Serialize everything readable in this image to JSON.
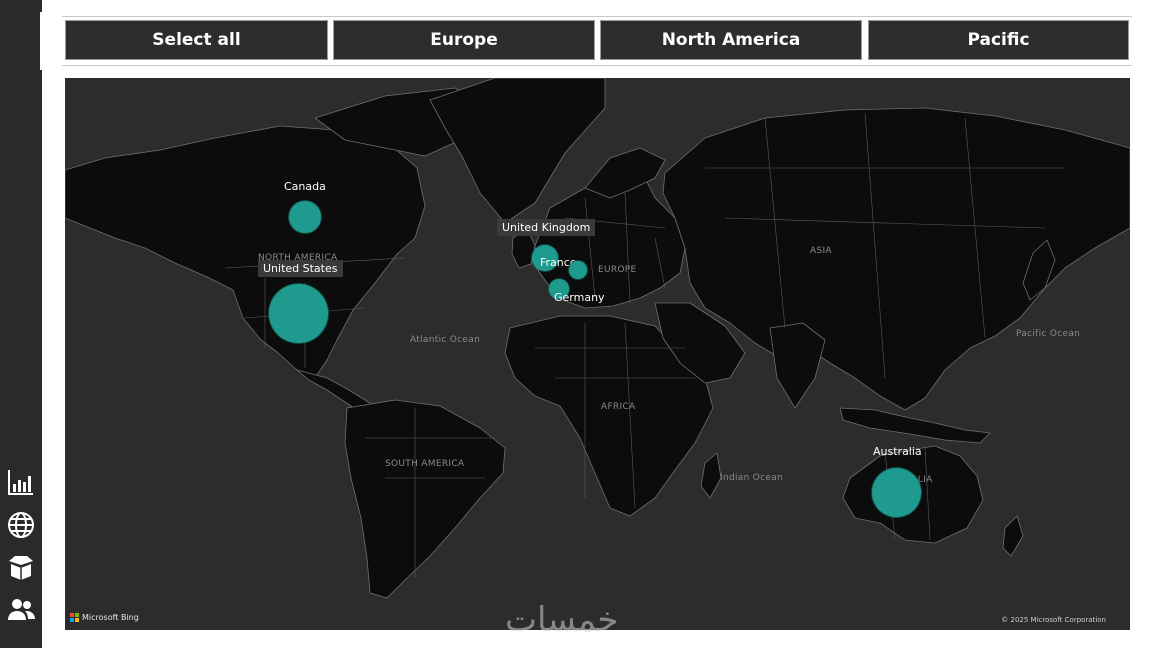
{
  "nav": {
    "items": [
      {
        "icon": "bar-chart-icon"
      },
      {
        "icon": "globe-icon"
      },
      {
        "icon": "box-icon"
      },
      {
        "icon": "users-icon"
      }
    ]
  },
  "slicer": {
    "buttons": [
      "Select all",
      "Europe",
      "North America",
      "Pacific"
    ]
  },
  "map": {
    "region_labels": [
      "NORTH AMERICA",
      "EUROPE",
      "ASIA",
      "AFRICA",
      "SOUTH AMERICA",
      "AUSTRALIA",
      "Atlantic Ocean",
      "Pacific Ocean",
      "Indian Ocean"
    ],
    "bubbles": [
      {
        "country": "Canada",
        "size": "small"
      },
      {
        "country": "United States",
        "size": "large"
      },
      {
        "country": "United Kingdom",
        "size": "small"
      },
      {
        "country": "France",
        "size": "small"
      },
      {
        "country": "Germany",
        "size": "small"
      },
      {
        "country": "Australia",
        "size": "medium"
      }
    ],
    "bubble_color": "#1f9a8e",
    "attribution": "Microsoft Bing",
    "copyright": "© 2025 Microsoft Corporation"
  },
  "watermark": "خمسات"
}
